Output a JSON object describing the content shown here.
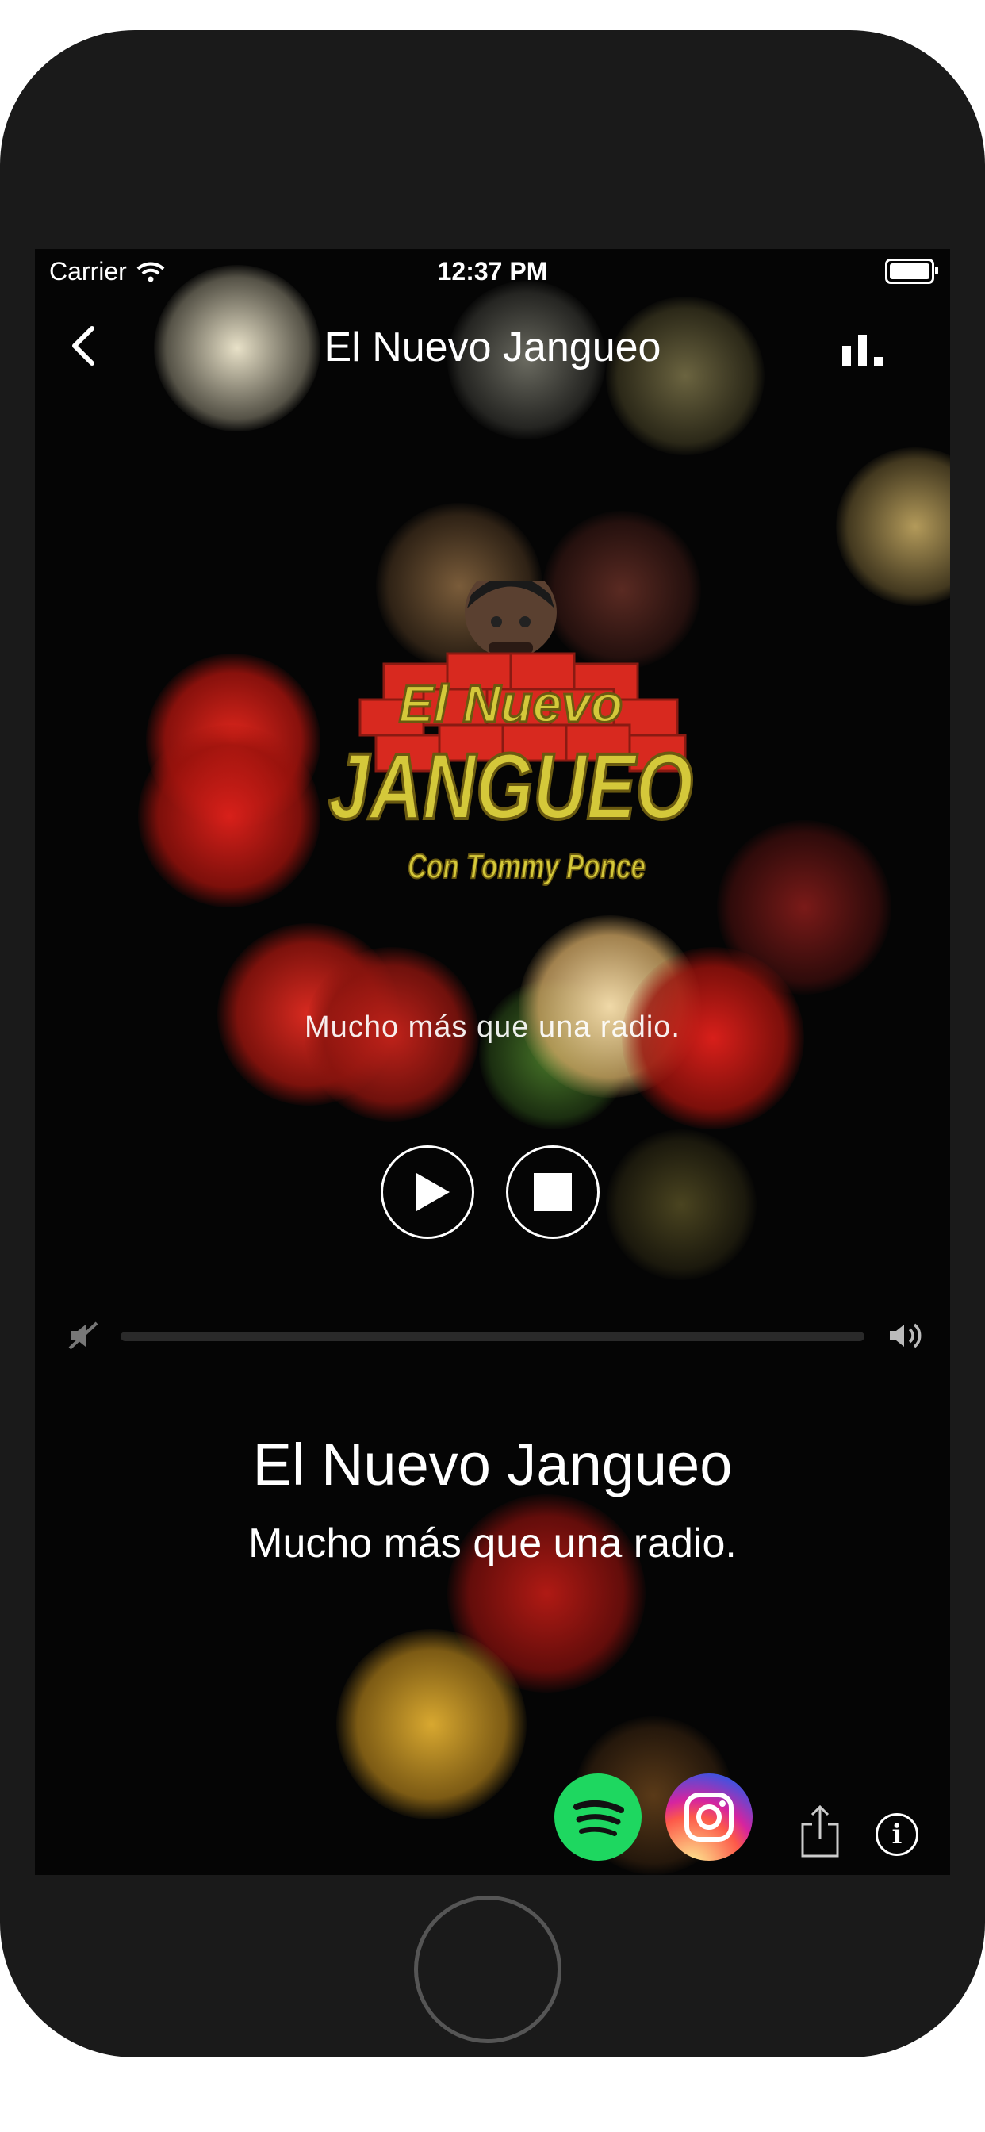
{
  "status_bar": {
    "carrier": "Carrier",
    "time": "12:37 PM"
  },
  "navbar": {
    "title": "El Nuevo Jangueo"
  },
  "logo": {
    "line1": "El Nuevo",
    "line2": "JANGUEO",
    "line3": "Con Tommy Ponce"
  },
  "player": {
    "tagline": "Mucho más que una radio.",
    "volume_level": 0
  },
  "now_playing": {
    "station_name": "El Nuevo Jangueo",
    "station_tagline": "Mucho más que una radio."
  },
  "colors": {
    "logo_yellow": "#d4c83a",
    "logo_red": "#d8291f",
    "spotify_green": "#1ed760",
    "background": "#050505"
  },
  "icons": [
    "back-chevron-icon",
    "equalizer-icon",
    "play-icon",
    "stop-icon",
    "volume-mute-icon",
    "volume-high-icon",
    "spotify-icon",
    "instagram-icon",
    "share-icon",
    "info-icon"
  ]
}
